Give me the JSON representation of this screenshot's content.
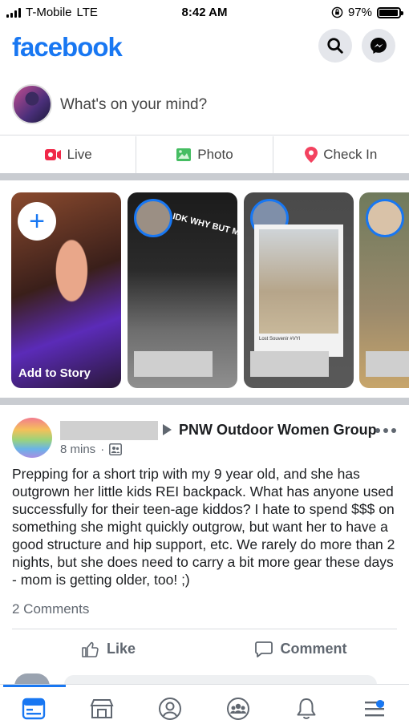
{
  "status_bar": {
    "carrier": "T-Mobile",
    "network": "LTE",
    "time": "8:42 AM",
    "battery": "97%",
    "battery_level": 0.97
  },
  "header": {
    "logo": "facebook",
    "search_icon": "search-icon",
    "messenger_icon": "messenger-icon",
    "brand_color": "#1877f2"
  },
  "composer": {
    "prompt": "What's on your mind?"
  },
  "actions": {
    "live": "Live",
    "photo": "Photo",
    "checkin": "Check In",
    "live_color": "#f02849",
    "photo_color": "#45bd62",
    "checkin_color": "#f3425f"
  },
  "stories": {
    "add_label": "Add to Story",
    "story2_text": "IDK WHY BUT MOOD",
    "story3_caption": "Lost Souvenir #VYl"
  },
  "post": {
    "group": "PNW Outdoor Women Group",
    "time": "8 mins",
    "body": "Prepping for a short trip with my 9 year old, and she has outgrown her little kids REI backpack. What has anyone used successfully for their teen-age kiddos? I hate to spend $$$ on something she might quickly outgrow, but want her to have a good structure and hip support, etc. We rarely do more than 2 nights, but she does need to carry a bit more gear these days - mom is getting older, too! ;)",
    "comments": "2 Comments",
    "like": "Like",
    "comment": "Comment"
  },
  "tabbar": {
    "items": [
      "news-feed-icon",
      "marketplace-icon",
      "profile-icon",
      "groups-icon",
      "notifications-icon",
      "menu-icon"
    ]
  }
}
